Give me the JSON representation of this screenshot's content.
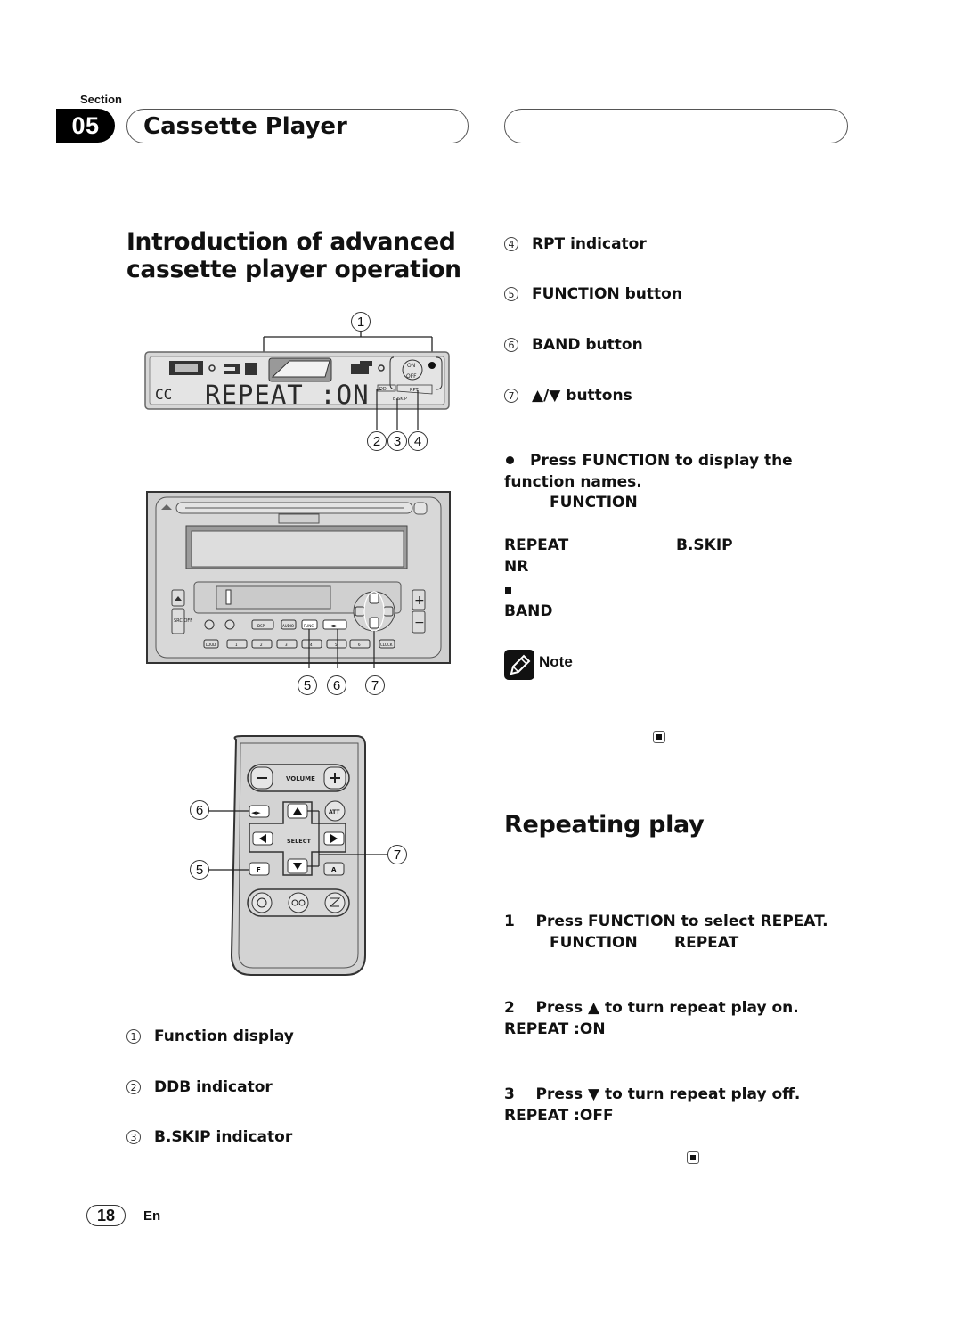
{
  "header": {
    "section_label": "Section",
    "section_number": "05",
    "chapter_title": "Cassette Player"
  },
  "intro": {
    "heading_line1": "Introduction of advanced",
    "heading_line2": "cassette player operation"
  },
  "lcd": {
    "main_text": "REPEAT :ON",
    "left_text": "CC",
    "on_label": "ON",
    "off_label": "OFF",
    "dolby_label": "DD",
    "rpt_label": "RPT",
    "bskip_label": "B.SKIP"
  },
  "head_unit": {
    "buttons": [
      "DSP",
      "AUDIO",
      "FUNC",
      "◄►",
      "LOUD",
      "1",
      "2",
      "3",
      "4",
      "5",
      "6",
      "CLOCK"
    ],
    "src_label": "SRC OFF",
    "plus": "+",
    "minus": "−"
  },
  "remote": {
    "volume_label": "VOLUME",
    "select_label": "SELECT",
    "att_label": "ATT",
    "f_label": "F",
    "a_label": "A",
    "band_label": "◄►"
  },
  "callouts": [
    "1",
    "2",
    "3",
    "4",
    "5",
    "6",
    "7"
  ],
  "legend_left": [
    {
      "num": "1",
      "text": "Function display"
    },
    {
      "num": "2",
      "text": "DDB indicator"
    },
    {
      "num": "3",
      "text": "B.SKIP indicator"
    }
  ],
  "legend_right": [
    {
      "num": "4",
      "text": "RPT indicator"
    },
    {
      "num": "5",
      "text": "FUNCTION button"
    },
    {
      "num": "6",
      "text": "BAND button"
    },
    {
      "num": "7",
      "text": "▲/▼ buttons"
    }
  ],
  "instructions": {
    "bullet_line1": "Press FUNCTION to display the",
    "bullet_line2": "function names.",
    "function_word": "FUNCTION",
    "repeat_word": "REPEAT",
    "bskip_word": "B.SKIP",
    "nr_word": "NR",
    "band_word": "BAND"
  },
  "note": {
    "label": "Note"
  },
  "repeating": {
    "heading": "Repeating play",
    "step1": "1    Press FUNCTION to select REPEAT.",
    "step1_a": "FUNCTION",
    "step1_b": "REPEAT",
    "step2": "2    Press ▲ to turn repeat play on.",
    "step2_result": "REPEAT :ON",
    "step3": "3    Press ▼ to turn repeat play off.",
    "step3_result": "REPEAT :OFF"
  },
  "footer": {
    "page_number": "18",
    "language": "En"
  }
}
